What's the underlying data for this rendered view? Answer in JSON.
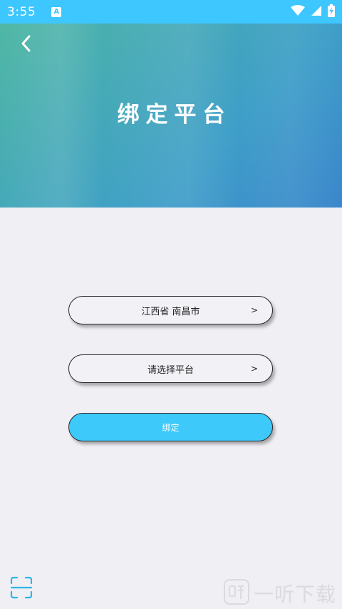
{
  "status_bar": {
    "time": "3:55",
    "app_icon_letter": "A",
    "icons": [
      "wifi-icon",
      "signal-icon",
      "battery-charging-icon"
    ]
  },
  "header": {
    "back_icon": "chevron-left-icon",
    "title": "绑定平台"
  },
  "form": {
    "region_value": "江西省 南昌市",
    "region_chevron": ">",
    "platform_placeholder": "请选择平台",
    "platform_chevron": ">",
    "bind_label": "绑定"
  },
  "footer": {
    "scan_icon": "scan-icon"
  },
  "watermark": {
    "text": "一听下载",
    "logo_icon": "yiting-logo-icon"
  },
  "colors": {
    "status_bar": "#3ec6ff",
    "primary_button": "#3ec9fb",
    "background": "#f0eff4",
    "scan_icon": "#2eb6e8"
  }
}
